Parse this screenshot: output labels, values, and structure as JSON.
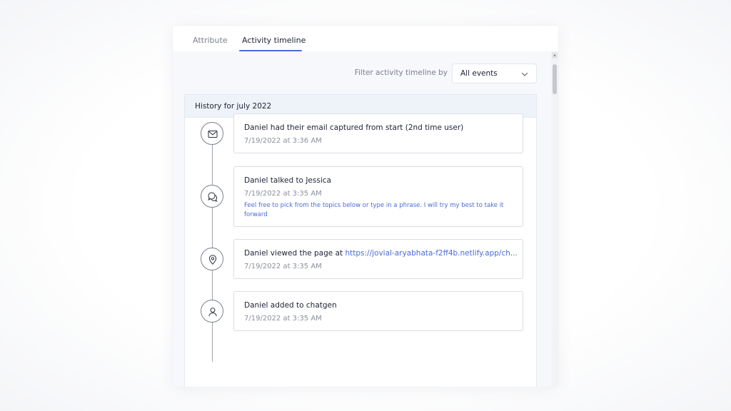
{
  "tabs": [
    {
      "label": "Attribute",
      "active": false
    },
    {
      "label": "Activity timeline",
      "active": true
    }
  ],
  "filter": {
    "label": "Filter activity timeline by",
    "selected": "All events",
    "icon": "chevron-down-icon"
  },
  "history": {
    "title": "History for july 2022"
  },
  "events": [
    {
      "icon": "mail-icon",
      "title": "Daniel had their email captured from start (2nd time user)",
      "time": "7/19/2022 at 3:36 AM"
    },
    {
      "icon": "chat-icon",
      "title": "Daniel talked to Jessica",
      "time": "7/19/2022 at 3:35 AM",
      "message": "Feel free to pick from the topics below or type in a phrase. I will try my best to take it forward"
    },
    {
      "icon": "location-pin-icon",
      "title_prefix": "Daniel viewed the page at ",
      "link": "https://jovial-aryabhata-f2ff4b.netlify.app/ch...",
      "time": "7/19/2022 at 3:35 AM"
    },
    {
      "icon": "user-icon",
      "title": "Daniel added to chatgen",
      "time": "7/19/2022 at 3:35 AM"
    }
  ],
  "colors": {
    "accent": "#4a6bd8",
    "text_primary": "#1d2233",
    "text_muted": "#8a8f9c",
    "header_bg": "#eef3fa"
  }
}
